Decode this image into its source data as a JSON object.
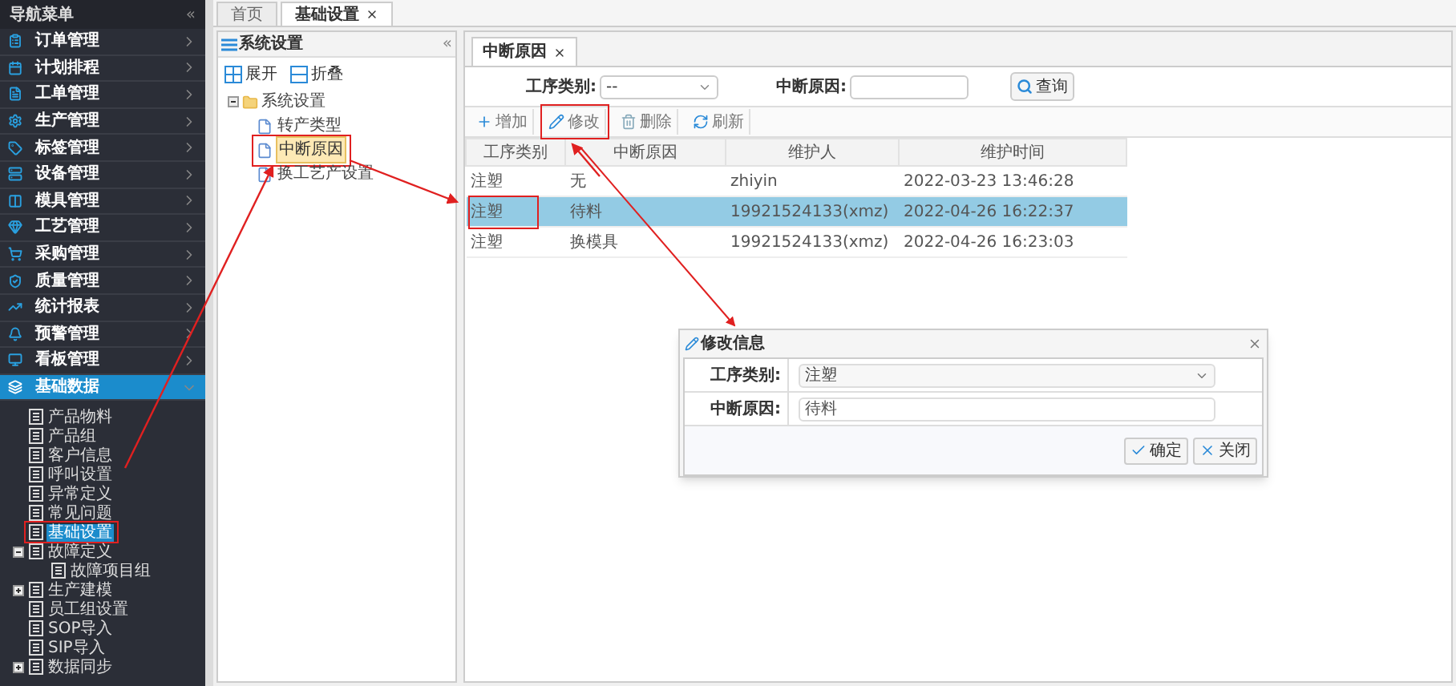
{
  "sidebar": {
    "title": "导航菜单",
    "collapse_glyph": "«",
    "menu": [
      {
        "label": "订单管理",
        "selected": false,
        "expanded": false
      },
      {
        "label": "计划排程",
        "selected": false,
        "expanded": false
      },
      {
        "label": "工单管理",
        "selected": false,
        "expanded": false
      },
      {
        "label": "生产管理",
        "selected": false,
        "expanded": false
      },
      {
        "label": "标签管理",
        "selected": false,
        "expanded": false
      },
      {
        "label": "设备管理",
        "selected": false,
        "expanded": false
      },
      {
        "label": "模具管理",
        "selected": false,
        "expanded": false
      },
      {
        "label": "工艺管理",
        "selected": false,
        "expanded": false
      },
      {
        "label": "采购管理",
        "selected": false,
        "expanded": false
      },
      {
        "label": "质量管理",
        "selected": false,
        "expanded": false
      },
      {
        "label": "统计报表",
        "selected": false,
        "expanded": false
      },
      {
        "label": "预警管理",
        "selected": false,
        "expanded": false
      },
      {
        "label": "看板管理",
        "selected": false,
        "expanded": false
      },
      {
        "label": "基础数据",
        "selected": true,
        "expanded": true
      }
    ],
    "tree": [
      {
        "label": "产品物料",
        "selected": false
      },
      {
        "label": "产品组",
        "selected": false
      },
      {
        "label": "客户信息",
        "selected": false
      },
      {
        "label": "呼叫设置",
        "selected": false
      },
      {
        "label": "异常定义",
        "selected": false
      },
      {
        "label": "常见问题",
        "selected": false
      },
      {
        "label": "基础设置",
        "selected": true
      },
      {
        "label": "故障定义",
        "selected": false,
        "expanded": true,
        "children": [
          {
            "label": "故障项目组",
            "selected": false
          }
        ]
      },
      {
        "label": "生产建模",
        "selected": false,
        "expanded": false
      },
      {
        "label": "员工组设置",
        "selected": false
      },
      {
        "label": "SOP导入",
        "selected": false
      },
      {
        "label": "SIP导入",
        "selected": false
      },
      {
        "label": "数据同步",
        "selected": false,
        "expanded": false
      }
    ]
  },
  "tabs": [
    {
      "label": "首页",
      "selected": false,
      "closable": false
    },
    {
      "label": "基础设置",
      "selected": true,
      "closable": true
    }
  ],
  "left_panel": {
    "title": "系统设置",
    "collapse_glyph": "«",
    "toolbar": [
      {
        "label": "展开",
        "kind": "expand"
      },
      {
        "label": "折叠",
        "kind": "collapse"
      }
    ],
    "tree": [
      {
        "label": "系统设置",
        "expanded": true,
        "children": [
          {
            "label": "转产类型",
            "selected": false
          },
          {
            "label": "中断原因",
            "selected": true
          },
          {
            "label": "换工艺产设置",
            "selected": false
          }
        ]
      }
    ]
  },
  "right_panel": {
    "tab": {
      "label": "中断原因",
      "selected": true,
      "closable": true
    },
    "filters": [
      {
        "label": "工序类别:",
        "kind": "select",
        "value": "--"
      },
      {
        "label": "中断原因:",
        "kind": "text"
      }
    ],
    "query_button": "查询",
    "toolbar": [
      {
        "label": "增加",
        "kind": "add"
      },
      {
        "label": "修改",
        "kind": "edit"
      },
      {
        "label": "删除",
        "kind": "delete"
      },
      {
        "label": "刷新",
        "kind": "refresh"
      }
    ],
    "table": {
      "columns": [
        "工序类别",
        "中断原因",
        "维护人",
        "维护时间"
      ],
      "rows": [
        {
          "selected": false,
          "cells": [
            "注塑",
            "无",
            "zhiyin",
            "2022-03-23 13:46:28"
          ]
        },
        {
          "selected": true,
          "cells": [
            "注塑",
            "待料",
            "19921524133(xmz)",
            "2022-04-26 16:22:37"
          ]
        },
        {
          "selected": false,
          "cells": [
            "注塑",
            "换模具",
            "19921524133(xmz)",
            "2022-04-26 16:23:03"
          ]
        }
      ]
    }
  },
  "dialog": {
    "title": "修改信息",
    "fields": [
      {
        "label": "工序类别:",
        "kind": "select",
        "value": "注塑"
      },
      {
        "label": "中断原因:",
        "kind": "text",
        "value": "待料"
      }
    ],
    "buttons": [
      {
        "label": "确定",
        "kind": "ok"
      },
      {
        "label": "关闭",
        "kind": "close"
      }
    ]
  }
}
